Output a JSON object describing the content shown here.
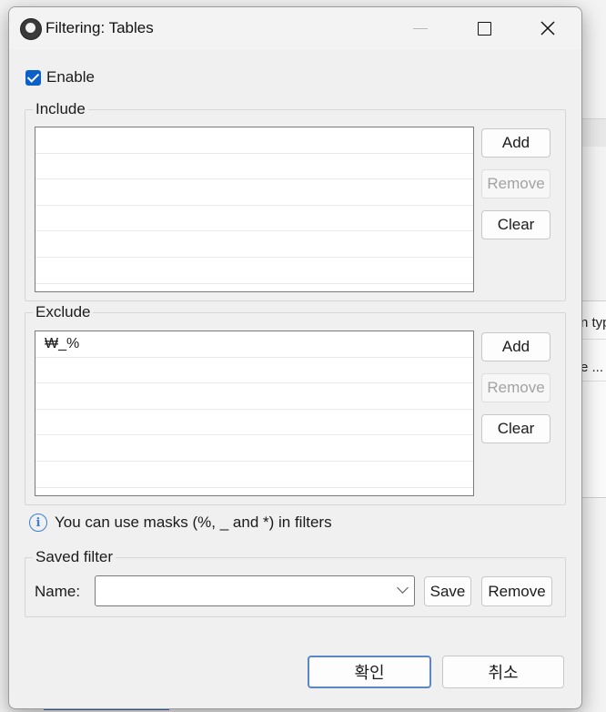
{
  "background": {
    "right_texts": [
      "n typ",
      "e ..."
    ]
  },
  "dialog": {
    "title": "Filtering: Tables",
    "enable_label": "Enable",
    "enabled": true,
    "include": {
      "legend": "Include",
      "items": [
        "",
        "",
        "",
        "",
        "",
        ""
      ],
      "add_label": "Add",
      "remove_label": "Remove",
      "clear_label": "Clear"
    },
    "exclude": {
      "legend": "Exclude",
      "items": [
        "₩_%",
        "",
        "",
        "",
        "",
        ""
      ],
      "add_label": "Add",
      "remove_label": "Remove",
      "clear_label": "Clear"
    },
    "info_text": "You can use masks (%, _ and *) in filters",
    "saved_filter": {
      "legend": "Saved filter",
      "name_label": "Name:",
      "name_value": "",
      "save_label": "Save",
      "remove_label": "Remove"
    },
    "ok_label": "확인",
    "cancel_label": "취소"
  },
  "colors": {
    "accent": "#0a61c9",
    "info": "#3b7dd8"
  }
}
